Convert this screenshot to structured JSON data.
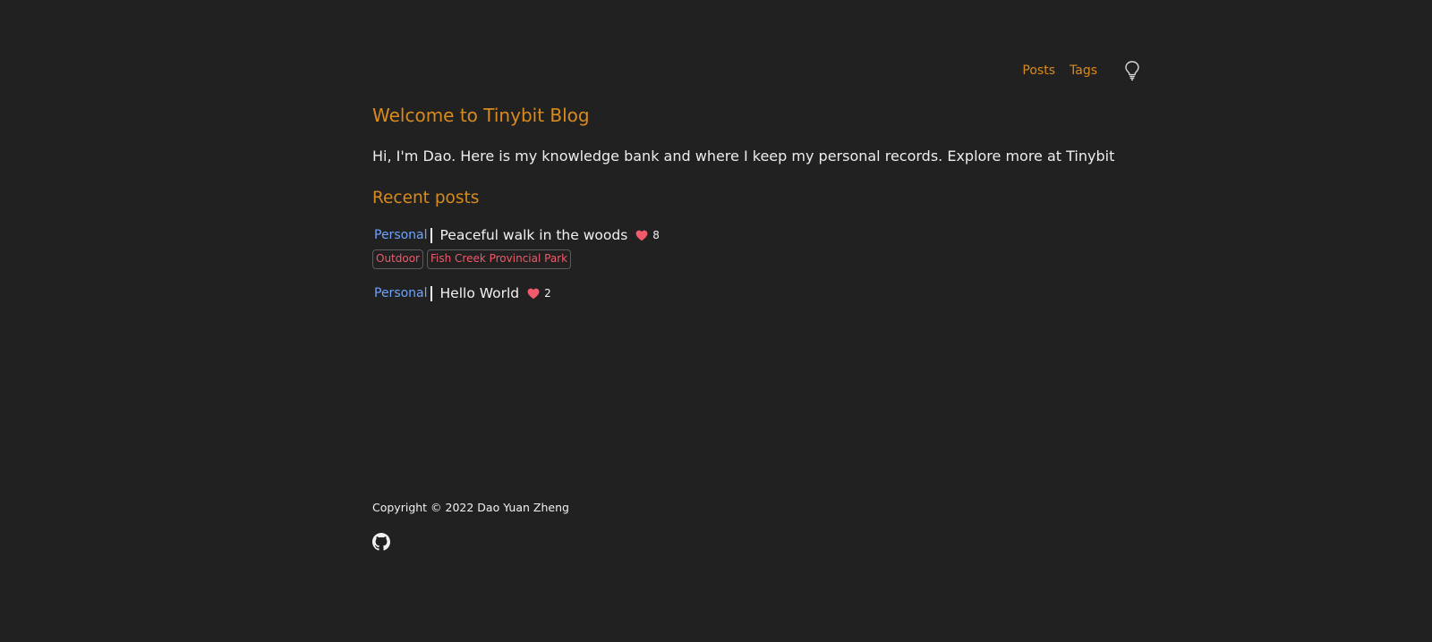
{
  "nav": {
    "links": [
      "Posts",
      "Tags"
    ],
    "theme_icon": "lightbulb-icon"
  },
  "main": {
    "heading": "Welcome to Tinybit Blog",
    "intro": "Hi, I'm Dao. Here is my knowledge bank and where I keep my personal records. Explore more at Tinybit",
    "recent_heading": "Recent posts",
    "posts": [
      {
        "category": "Personal",
        "title": "Peaceful walk in the woods",
        "likes": "8",
        "tags": [
          "Outdoor",
          "Fish Creek Provincial Park"
        ]
      },
      {
        "category": "Personal",
        "title": "Hello World",
        "likes": "2",
        "tags": []
      }
    ]
  },
  "footer": {
    "copyright": "Copyright © 2022 Dao Yuan Zheng",
    "social_icon": "github-icon"
  },
  "colors": {
    "background": "#212121",
    "accent": "#d98a1c",
    "category": "#6ea3ff",
    "tag": "#f05a6a",
    "heart": "#f05a6a"
  }
}
